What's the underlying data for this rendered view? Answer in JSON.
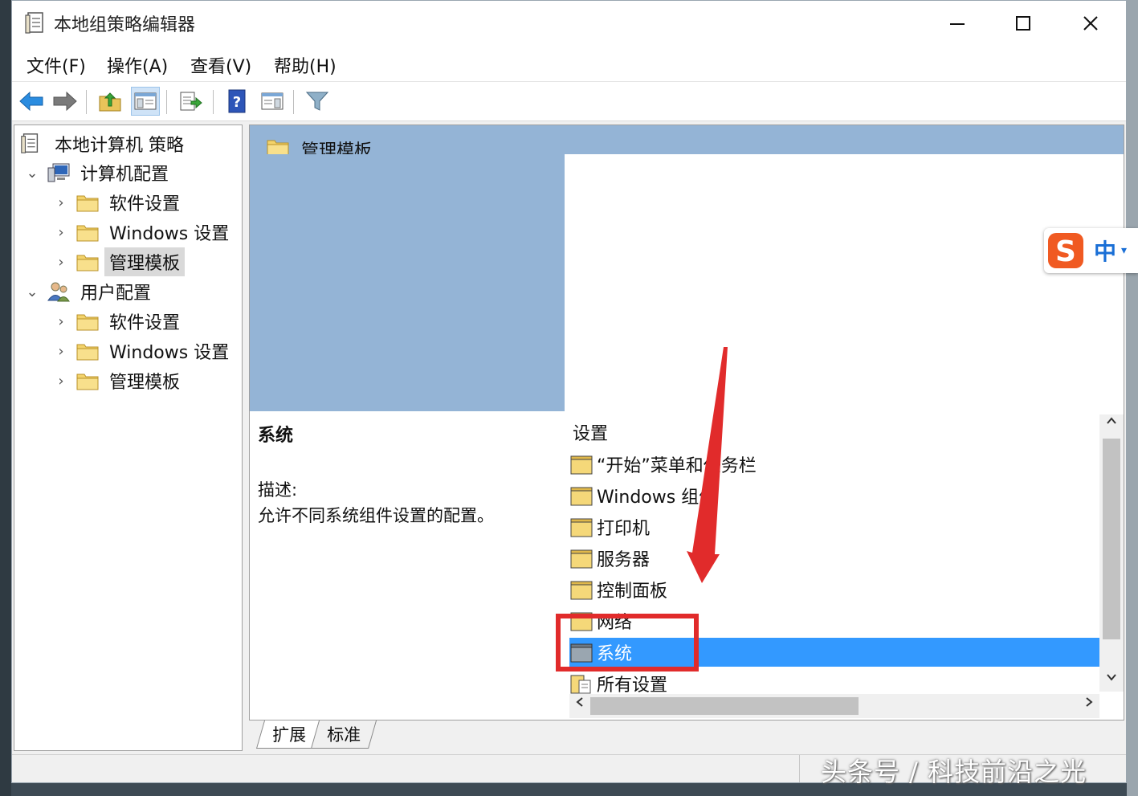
{
  "window": {
    "title": "本地组策略编辑器",
    "controls": {
      "minimize": "—",
      "maximize": "☐",
      "close": "✕"
    }
  },
  "menu": [
    "文件(F)",
    "操作(A)",
    "查看(V)",
    "帮助(H)"
  ],
  "tree": {
    "root": "本地计算机 策略",
    "computer": {
      "label": "计算机配置",
      "children": [
        "软件设置",
        "Windows 设置",
        "管理模板"
      ]
    },
    "user": {
      "label": "用户配置",
      "children": [
        "软件设置",
        "Windows 设置",
        "管理模板"
      ]
    }
  },
  "header": {
    "title": "管理模板"
  },
  "description": {
    "title": "系统",
    "label": "描述:",
    "text": "允许不同系统组件设置的配置。"
  },
  "list": {
    "header": "设置",
    "items": [
      "“开始”菜单和任务栏",
      "Windows 组件",
      "打印机",
      "服务器",
      "控制面板",
      "网络",
      "系统",
      "所有设置"
    ],
    "selected_index": 6
  },
  "tabs": [
    "扩展",
    "标准"
  ],
  "ime": {
    "label": "中"
  },
  "watermark": "头条号 / 科技前沿之光",
  "colors": {
    "accent_selection": "#3399ff",
    "header_band": "#94b4d6",
    "annotation_red": "#e12b2b"
  }
}
